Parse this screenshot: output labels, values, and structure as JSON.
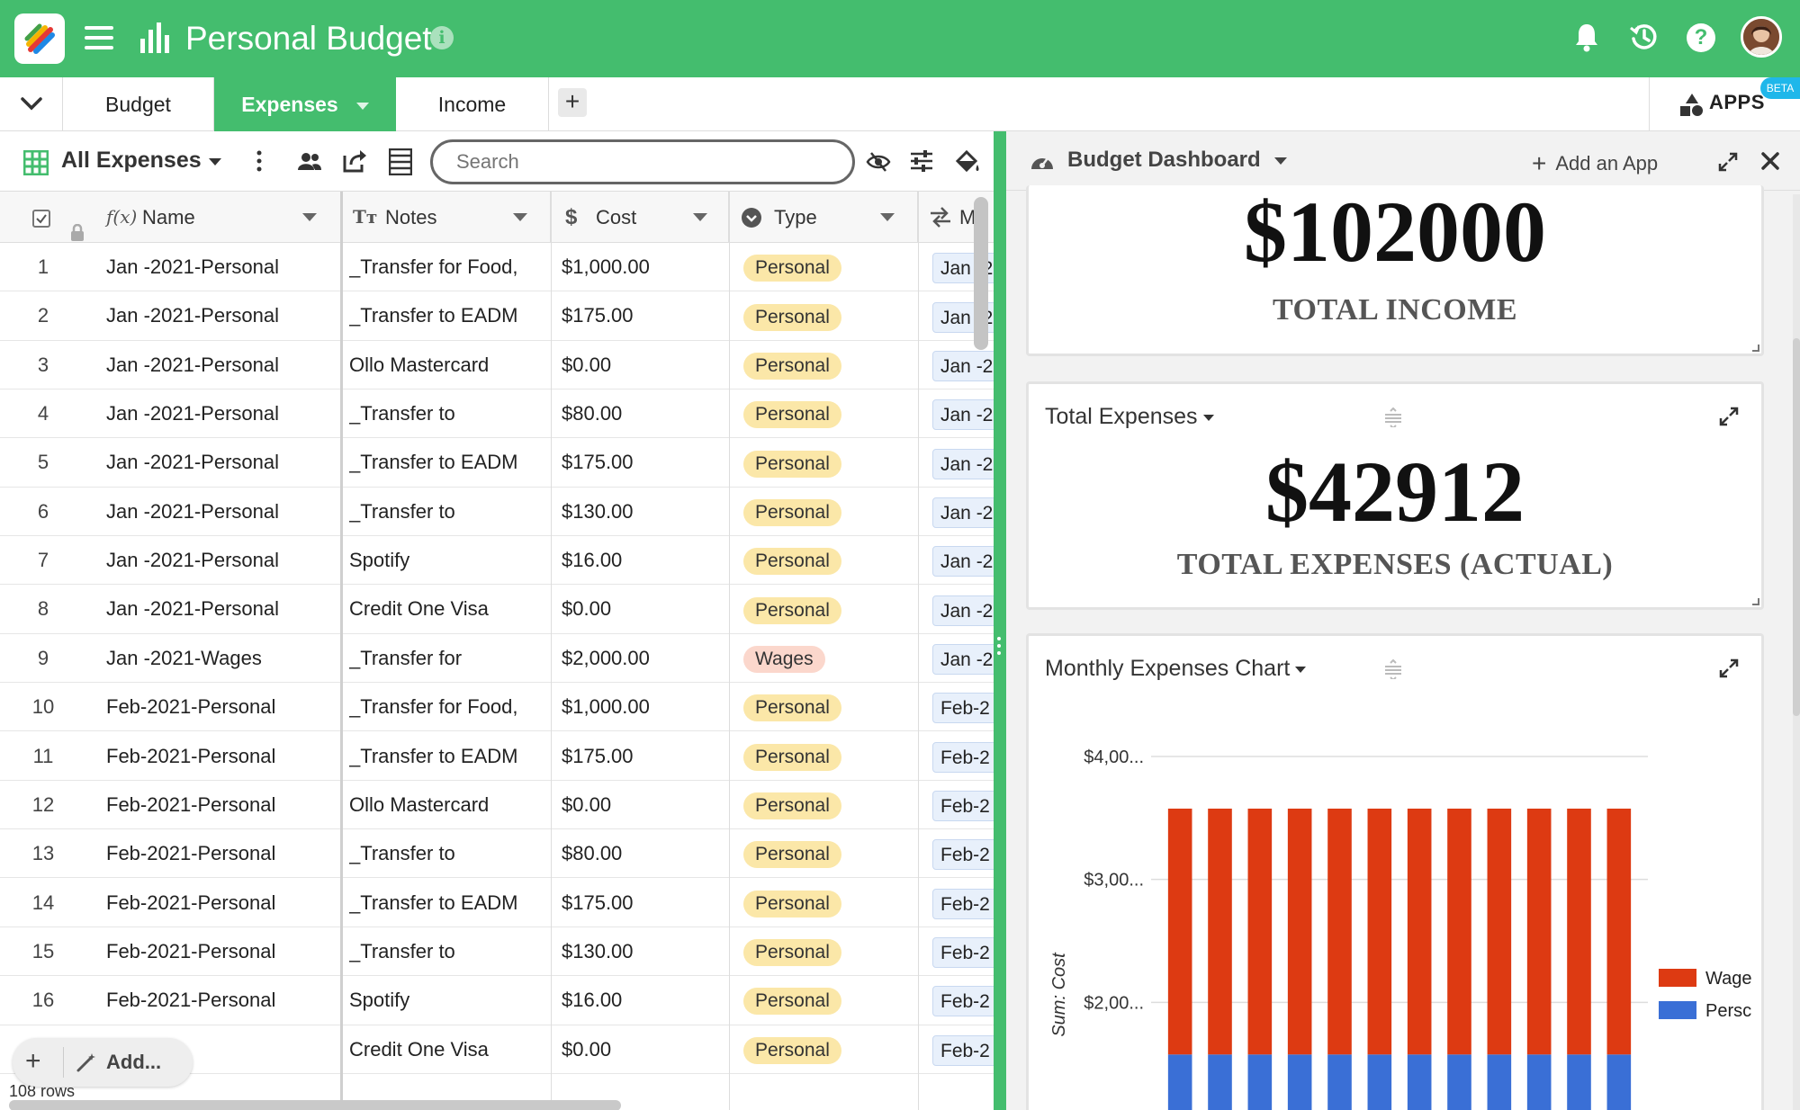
{
  "app": {
    "title": "Personal Budget"
  },
  "tabs": [
    {
      "label": "Budget"
    },
    {
      "label": "Expenses"
    },
    {
      "label": "Income"
    }
  ],
  "apps_button": {
    "label": "APPS",
    "badge": "BETA"
  },
  "toolbar": {
    "view_name": "All Expenses",
    "search_placeholder": "Search"
  },
  "grid": {
    "columns": [
      {
        "label": "Name"
      },
      {
        "label": "Notes"
      },
      {
        "label": "Cost"
      },
      {
        "label": "Type"
      },
      {
        "label": "Mo"
      }
    ],
    "rows": [
      {
        "num": "1",
        "name": "Jan -2021-Personal",
        "notes": "_Transfer for Food,",
        "cost": "$1,000.00",
        "type": "Personal",
        "month": "Jan -2"
      },
      {
        "num": "2",
        "name": "Jan -2021-Personal",
        "notes": "_Transfer to EADM",
        "cost": "$175.00",
        "type": "Personal",
        "month": "Jan -2"
      },
      {
        "num": "3",
        "name": "Jan -2021-Personal",
        "notes": "Ollo Mastercard",
        "cost": "$0.00",
        "type": "Personal",
        "month": "Jan -2"
      },
      {
        "num": "4",
        "name": "Jan -2021-Personal",
        "notes": "_Transfer to",
        "cost": "$80.00",
        "type": "Personal",
        "month": "Jan -2"
      },
      {
        "num": "5",
        "name": "Jan -2021-Personal",
        "notes": "_Transfer to EADM",
        "cost": "$175.00",
        "type": "Personal",
        "month": "Jan -2"
      },
      {
        "num": "6",
        "name": "Jan -2021-Personal",
        "notes": "_Transfer to",
        "cost": "$130.00",
        "type": "Personal",
        "month": "Jan -2"
      },
      {
        "num": "7",
        "name": "Jan -2021-Personal",
        "notes": "Spotify",
        "cost": "$16.00",
        "type": "Personal",
        "month": "Jan -2"
      },
      {
        "num": "8",
        "name": "Jan -2021-Personal",
        "notes": "Credit One Visa",
        "cost": "$0.00",
        "type": "Personal",
        "month": "Jan -2"
      },
      {
        "num": "9",
        "name": "Jan -2021-Wages",
        "notes": "_Transfer for",
        "cost": "$2,000.00",
        "type": "Wages",
        "month": "Jan -2"
      },
      {
        "num": "10",
        "name": "Feb-2021-Personal",
        "notes": "_Transfer for Food,",
        "cost": "$1,000.00",
        "type": "Personal",
        "month": "Feb-2"
      },
      {
        "num": "11",
        "name": "Feb-2021-Personal",
        "notes": "_Transfer to EADM",
        "cost": "$175.00",
        "type": "Personal",
        "month": "Feb-2"
      },
      {
        "num": "12",
        "name": "Feb-2021-Personal",
        "notes": "Ollo Mastercard",
        "cost": "$0.00",
        "type": "Personal",
        "month": "Feb-2"
      },
      {
        "num": "13",
        "name": "Feb-2021-Personal",
        "notes": "_Transfer to",
        "cost": "$80.00",
        "type": "Personal",
        "month": "Feb-2"
      },
      {
        "num": "14",
        "name": "Feb-2021-Personal",
        "notes": "_Transfer to EADM",
        "cost": "$175.00",
        "type": "Personal",
        "month": "Feb-2"
      },
      {
        "num": "15",
        "name": "Feb-2021-Personal",
        "notes": "_Transfer to",
        "cost": "$130.00",
        "type": "Personal",
        "month": "Feb-2"
      },
      {
        "num": "16",
        "name": "Feb-2021-Personal",
        "notes": "Spotify",
        "cost": "$16.00",
        "type": "Personal",
        "month": "Feb-2"
      },
      {
        "num": "",
        "name": "",
        "notes": "Credit One Visa",
        "cost": "$0.00",
        "type": "Personal",
        "month": "Feb-2"
      }
    ],
    "add_label": "Add...",
    "row_count": "108 rows"
  },
  "dashboard": {
    "title": "Budget Dashboard",
    "add_app_label": "Add an App",
    "income_card": {
      "value": "$102000",
      "label": "TOTAL INCOME"
    },
    "expenses_card": {
      "title": "Total Expenses",
      "value": "$42912",
      "label": "TOTAL EXPENSES (ACTUAL)"
    },
    "chart_card": {
      "title": "Monthly Expenses Chart"
    }
  },
  "colors": {
    "brand_green": "#44bd6e",
    "wages_red": "#dd3a12",
    "personal_blue": "#3a6fd6",
    "personal_pill": "#fbe7a8",
    "wages_pill": "#fbd7cc"
  },
  "chart_data": {
    "type": "bar",
    "stacked": true,
    "ylabel": "Sum: Cost",
    "y_ticks": [
      "$4,00...",
      "$3,00...",
      "$2,00...",
      "$1,00..."
    ],
    "y_tick_values": [
      4000,
      3000,
      2000,
      1000
    ],
    "ylim": [
      1000,
      4000
    ],
    "series": [
      {
        "name": "Persc",
        "color": "#3a6fd6",
        "values": [
          1576,
          1576,
          1576,
          1576,
          1576,
          1576,
          1576,
          1576,
          1576,
          1576,
          1576,
          1576
        ]
      },
      {
        "name": "Wage",
        "color": "#dd3a12",
        "values": [
          2000,
          2000,
          2000,
          2000,
          2000,
          2000,
          2000,
          2000,
          2000,
          2000,
          2000,
          2000
        ]
      }
    ],
    "legend": "right",
    "grid": true
  }
}
